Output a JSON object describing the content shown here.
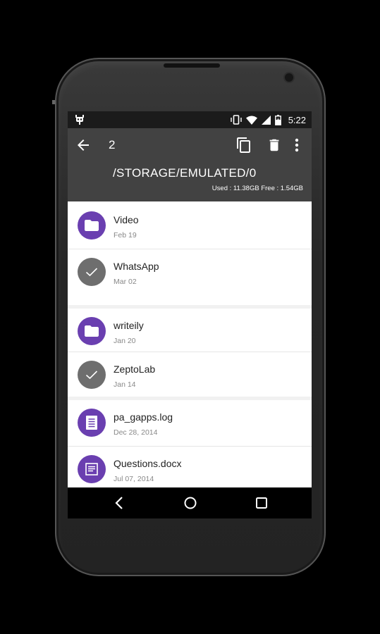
{
  "status": {
    "time": "5:22",
    "icons": [
      "app-notification-icon",
      "vibrate-icon",
      "wifi-icon",
      "signal-icon",
      "battery-charging-icon"
    ]
  },
  "toolbar": {
    "back_icon": "arrow-back-icon",
    "selected_count": "2",
    "actions": [
      "copy-icon",
      "delete-icon",
      "more-vert-icon"
    ]
  },
  "header": {
    "path": "/STORAGE/EMULATED/0",
    "storage": "Used : 11.38GB Free : 1.54GB"
  },
  "files": [
    {
      "name": "Video",
      "date": "Feb 19",
      "icon": "folder-icon",
      "selected": false
    },
    {
      "name": "WhatsApp",
      "date": "Mar 02",
      "icon": "check-icon",
      "selected": true
    },
    {
      "name": "writeily",
      "date": "Jan 20",
      "icon": "folder-icon",
      "selected": false
    },
    {
      "name": "ZeptoLab",
      "date": "Jan 14",
      "icon": "check-icon",
      "selected": true
    },
    {
      "name": "pa_gapps.log",
      "date": "Dec 28, 2014",
      "icon": "log-file-icon",
      "selected": false
    },
    {
      "name": "Questions.docx",
      "date": "Jul 07, 2014",
      "icon": "document-icon",
      "selected": false
    }
  ],
  "navbar": [
    "nav-back-icon",
    "nav-home-icon",
    "nav-recents-icon"
  ],
  "colors": {
    "accent": "#6a3fb0",
    "appbar": "#424242",
    "selected": "#6e6e6e",
    "statusbar": "#1b1b1b"
  }
}
